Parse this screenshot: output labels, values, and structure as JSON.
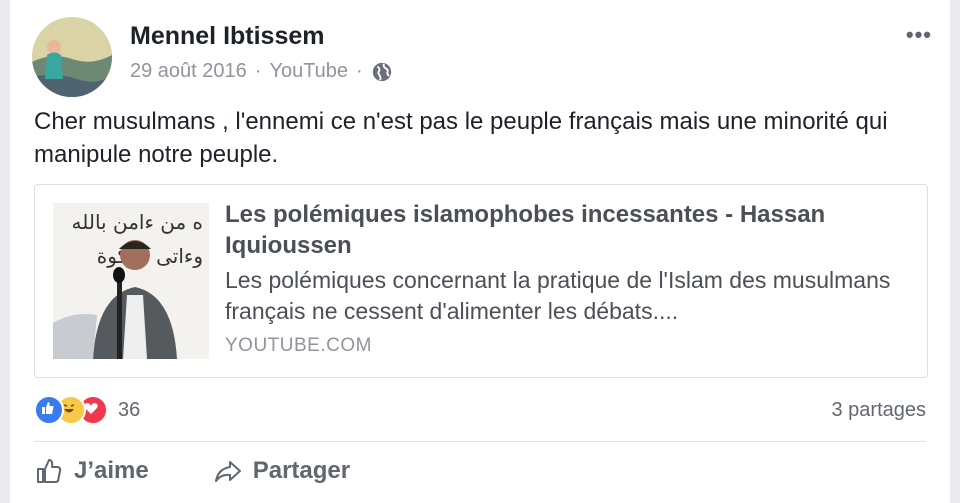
{
  "post": {
    "author": "Mennel Ibtissem",
    "date": "29 août 2016",
    "separator": "·",
    "source": "YouTube",
    "text": "Cher musulmans , l'ennemi ce n'est pas le peuple français mais une minorité qui manipule notre peuple.",
    "privacy_icon": "globe-icon",
    "more_icon": "ellipsis-icon"
  },
  "link": {
    "title": "Les polémiques islamophobes incessantes - Hassan Iquioussen",
    "description": "Les polémiques concernant la pratique de l'Islam des musulmans français ne cessent d'alimenter les débats....",
    "domain": "YOUTUBE.COM",
    "thumbnail_text": "ه من ءامن بالله وءاتى الزكوة"
  },
  "engagement": {
    "reactions": [
      "like",
      "haha",
      "love"
    ],
    "reaction_count": "36",
    "shares": "3 partages"
  },
  "actions": {
    "like_label": "J’aime",
    "share_label": "Partager"
  },
  "colors": {
    "like": "#3b7bf0",
    "haha": "#f7c948",
    "love": "#f0384f"
  }
}
